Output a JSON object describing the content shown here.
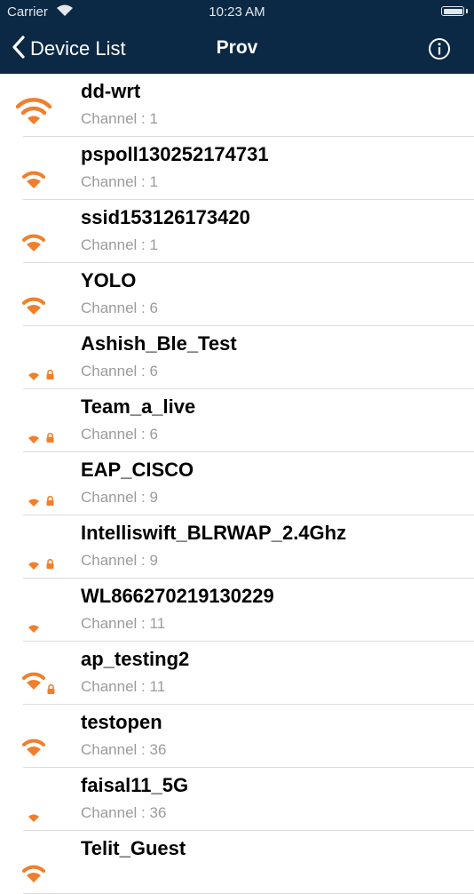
{
  "status_bar": {
    "carrier": "Carrier",
    "time": "10:23 AM",
    "wifi_icon": "wifi-icon",
    "battery_icon": "battery-icon"
  },
  "nav": {
    "back_label": "Device List",
    "title": "Prov",
    "info_icon": "info-icon"
  },
  "colors": {
    "nav_background": "#0b2944",
    "signal_orange": "#f07f2c",
    "channel_gray": "#9b9b9b"
  },
  "networks": [
    {
      "name": "dd-wrt",
      "channel": "Channel : 1",
      "signal": 3,
      "secured": false
    },
    {
      "name": "pspoll130252174731",
      "channel": "Channel : 1",
      "signal": 2,
      "secured": false
    },
    {
      "name": "ssid153126173420",
      "channel": "Channel : 1",
      "signal": 2,
      "secured": false
    },
    {
      "name": "YOLO",
      "channel": "Channel : 6",
      "signal": 2,
      "secured": false
    },
    {
      "name": "Ashish_Ble_Test",
      "channel": "Channel : 6",
      "signal": 1,
      "secured": true
    },
    {
      "name": "Team_a_live",
      "channel": "Channel : 6",
      "signal": 1,
      "secured": true
    },
    {
      "name": "EAP_CISCO",
      "channel": "Channel : 9",
      "signal": 1,
      "secured": true
    },
    {
      "name": "Intelliswift_BLRWAP_2.4Ghz",
      "channel": "Channel : 9",
      "signal": 1,
      "secured": true
    },
    {
      "name": "WL866270219130229",
      "channel": "Channel : 11",
      "signal": 1,
      "secured": false
    },
    {
      "name": "ap_testing2",
      "channel": "Channel : 11",
      "signal": 2,
      "secured": true
    },
    {
      "name": "testopen",
      "channel": "Channel : 36",
      "signal": 2,
      "secured": false
    },
    {
      "name": "faisal11_5G",
      "channel": "Channel : 36",
      "signal": 1,
      "secured": false
    },
    {
      "name": "Telit_Guest",
      "channel": "",
      "signal": 2,
      "secured": false
    }
  ]
}
